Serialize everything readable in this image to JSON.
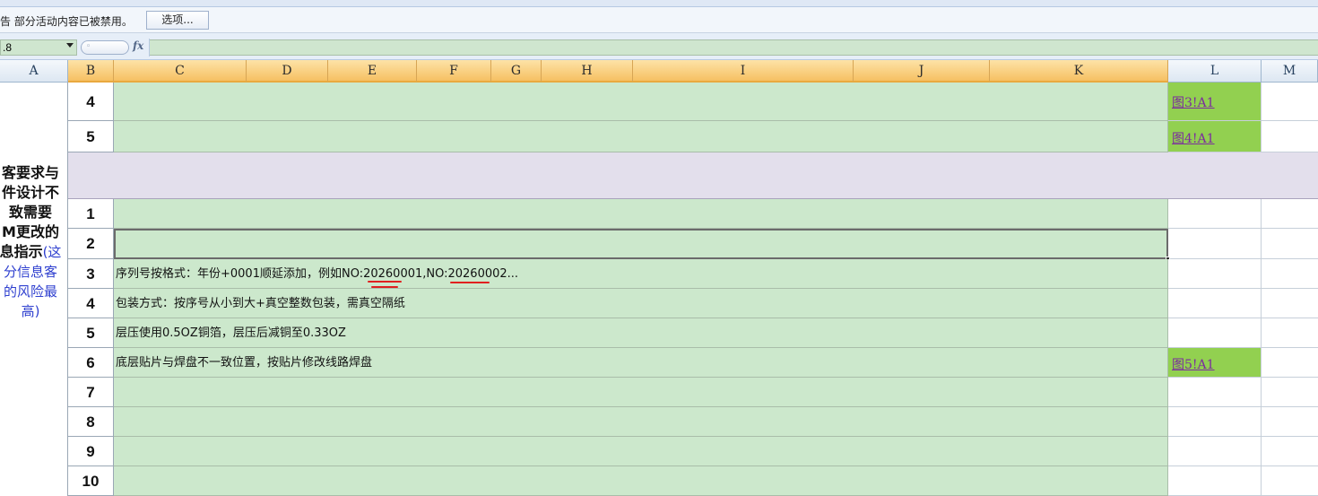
{
  "message_bar": {
    "text": "告  部分活动内容已被禁用。",
    "options_button": "选项..."
  },
  "formula_bar": {
    "name_box": ".8",
    "fx_label": "fx",
    "formula": ""
  },
  "columns": [
    "A",
    "B",
    "C",
    "D",
    "E",
    "F",
    "G",
    "H",
    "I",
    "J",
    "K",
    "L",
    "M"
  ],
  "side_note": {
    "lines": [
      "客要求与",
      "件设计不",
      "致需要",
      "M更改的",
      "息指示"
    ],
    "blue_lines": [
      "(这",
      "分信息客",
      "的风险最",
      "高)"
    ]
  },
  "rows_top": [
    {
      "b": "4",
      "c": "",
      "link": "图3!A1"
    },
    {
      "b": "5",
      "c": "",
      "link": "图4!A1"
    }
  ],
  "rows_bottom": [
    {
      "b": "1",
      "c": "",
      "link": ""
    },
    {
      "b": "2",
      "c": "",
      "link": ""
    },
    {
      "b": "3",
      "c": "序列号按格式：年份+0001顺延添加，例如NO:20260001,NO:20260002...",
      "link": ""
    },
    {
      "b": "4",
      "c": "包装方式：按序号从小到大+真空整数包装，需真空隔纸",
      "link": ""
    },
    {
      "b": "5",
      "c": "层压使用0.5OZ铜箔，层压后减铜至0.33OZ",
      "link": ""
    },
    {
      "b": "6",
      "c": "底层贴片与焊盘不一致位置，按贴片修改线路焊盘",
      "link": "图5!A1"
    },
    {
      "b": "7",
      "c": "",
      "link": ""
    },
    {
      "b": "8",
      "c": "",
      "link": ""
    },
    {
      "b": "9",
      "c": "",
      "link": ""
    },
    {
      "b": "10",
      "c": "",
      "link": ""
    }
  ]
}
